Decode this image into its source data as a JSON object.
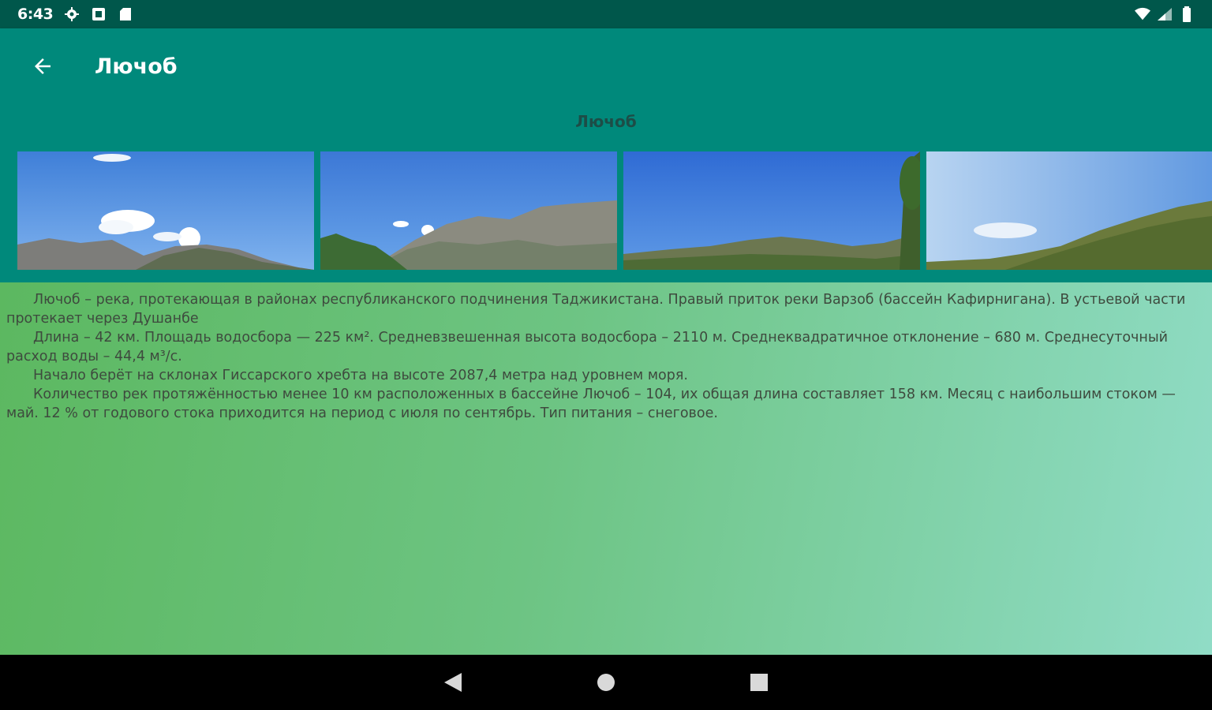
{
  "status_bar": {
    "time": "6:43",
    "icons_left": [
      "gear-icon",
      "square-notification-icon",
      "sd-card-icon"
    ],
    "icons_right": [
      "wifi-icon",
      "signal-icon",
      "battery-icon"
    ]
  },
  "toolbar": {
    "title": "Лючоб",
    "back_icon": "arrow-left-icon"
  },
  "gallery": {
    "heading": "Лючоб",
    "photos": [
      {
        "name": "photo-1",
        "description": "mountain-sky-clouds"
      },
      {
        "name": "photo-2",
        "description": "mountain-ridge-trees"
      },
      {
        "name": "photo-3",
        "description": "green-hills-tree"
      },
      {
        "name": "photo-4",
        "description": "forested-slope"
      }
    ]
  },
  "content": {
    "paragraphs": [
      "Лючоб – река, протекающая в районах республиканского подчинения Таджикистана. Правый приток реки Варзоб (бассейн Кафирнигана). В устьевой части протекает через Душанбе",
      "Длина – 42 км. Площадь водосбора — 225 км². Средневзвешенная высота водосбора – 2110 м. Среднеквадратичное отклонение – 680 м. Среднесуточный расход воды – 44,4 м³/с.",
      "Начало берёт на склонах Гиссарского хребта на высоте 2087,4 метра над уровнем моря.",
      "Количество рек протяжённостью менее 10 км расположенных в бассейне Лючоб – 104, их общая длина составляет 158 км. Месяц с наибольшим стоком — май. 12 % от годового стока приходится на период с июля по сентябрь. Тип питания – снеговое."
    ]
  },
  "colors": {
    "status_bar": "#00574b",
    "toolbar": "#00897b",
    "gradient_start": "#5cb860",
    "gradient_end": "#90dcc6"
  },
  "nav_bar": {
    "buttons": [
      "back-triangle-icon",
      "home-circle-icon",
      "recents-square-icon"
    ]
  }
}
